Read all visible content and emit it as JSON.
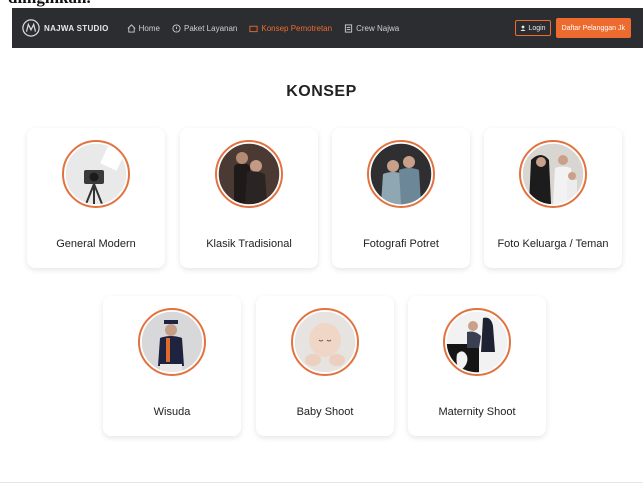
{
  "caption": "diinginkan.",
  "navbar": {
    "brand": "NAJWA STUDIO",
    "links": [
      {
        "label": "Home",
        "icon": "home-icon"
      },
      {
        "label": "Paket Layanan",
        "icon": "package-icon"
      },
      {
        "label": "Konsep Pemotretan",
        "icon": "camera-icon",
        "active": true
      },
      {
        "label": "Crew Najwa",
        "icon": "crew-icon"
      }
    ],
    "login_label": "Login",
    "register_label": "Daftar Pelanggan Jk"
  },
  "section_title": "KONSEP",
  "concepts": [
    {
      "label": "General Modern",
      "icon": "camera-studio-photo"
    },
    {
      "label": "Klasik Tradisional",
      "icon": "couple-traditional-photo"
    },
    {
      "label": "Fotografi Potret",
      "icon": "couple-portrait-photo"
    },
    {
      "label": "Foto Keluarga / Teman",
      "icon": "family-photo"
    },
    {
      "label": "Wisuda",
      "icon": "graduation-photo"
    },
    {
      "label": "Baby Shoot",
      "icon": "baby-photo"
    },
    {
      "label": "Maternity Shoot",
      "icon": "maternity-photo"
    }
  ],
  "colors": {
    "navbar_bg": "#2b2d31",
    "accent": "#ee6b2f",
    "card_bg": "#ffffff"
  }
}
